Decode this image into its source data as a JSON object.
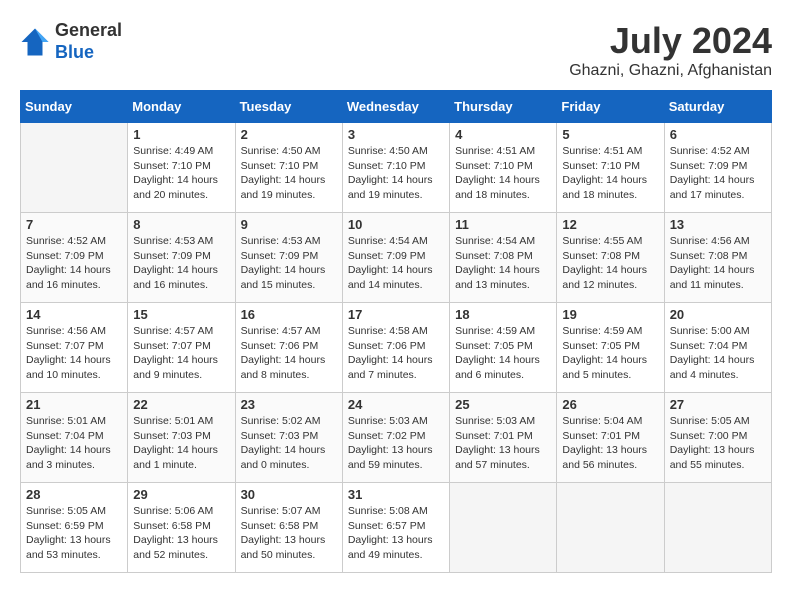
{
  "header": {
    "logo_line1": "General",
    "logo_line2": "Blue",
    "month_year": "July 2024",
    "location": "Ghazni, Ghazni, Afghanistan"
  },
  "weekdays": [
    "Sunday",
    "Monday",
    "Tuesday",
    "Wednesday",
    "Thursday",
    "Friday",
    "Saturday"
  ],
  "weeks": [
    [
      {
        "day": "",
        "info": ""
      },
      {
        "day": "1",
        "info": "Sunrise: 4:49 AM\nSunset: 7:10 PM\nDaylight: 14 hours\nand 20 minutes."
      },
      {
        "day": "2",
        "info": "Sunrise: 4:50 AM\nSunset: 7:10 PM\nDaylight: 14 hours\nand 19 minutes."
      },
      {
        "day": "3",
        "info": "Sunrise: 4:50 AM\nSunset: 7:10 PM\nDaylight: 14 hours\nand 19 minutes."
      },
      {
        "day": "4",
        "info": "Sunrise: 4:51 AM\nSunset: 7:10 PM\nDaylight: 14 hours\nand 18 minutes."
      },
      {
        "day": "5",
        "info": "Sunrise: 4:51 AM\nSunset: 7:10 PM\nDaylight: 14 hours\nand 18 minutes."
      },
      {
        "day": "6",
        "info": "Sunrise: 4:52 AM\nSunset: 7:09 PM\nDaylight: 14 hours\nand 17 minutes."
      }
    ],
    [
      {
        "day": "7",
        "info": "Sunrise: 4:52 AM\nSunset: 7:09 PM\nDaylight: 14 hours\nand 16 minutes."
      },
      {
        "day": "8",
        "info": "Sunrise: 4:53 AM\nSunset: 7:09 PM\nDaylight: 14 hours\nand 16 minutes."
      },
      {
        "day": "9",
        "info": "Sunrise: 4:53 AM\nSunset: 7:09 PM\nDaylight: 14 hours\nand 15 minutes."
      },
      {
        "day": "10",
        "info": "Sunrise: 4:54 AM\nSunset: 7:09 PM\nDaylight: 14 hours\nand 14 minutes."
      },
      {
        "day": "11",
        "info": "Sunrise: 4:54 AM\nSunset: 7:08 PM\nDaylight: 14 hours\nand 13 minutes."
      },
      {
        "day": "12",
        "info": "Sunrise: 4:55 AM\nSunset: 7:08 PM\nDaylight: 14 hours\nand 12 minutes."
      },
      {
        "day": "13",
        "info": "Sunrise: 4:56 AM\nSunset: 7:08 PM\nDaylight: 14 hours\nand 11 minutes."
      }
    ],
    [
      {
        "day": "14",
        "info": "Sunrise: 4:56 AM\nSunset: 7:07 PM\nDaylight: 14 hours\nand 10 minutes."
      },
      {
        "day": "15",
        "info": "Sunrise: 4:57 AM\nSunset: 7:07 PM\nDaylight: 14 hours\nand 9 minutes."
      },
      {
        "day": "16",
        "info": "Sunrise: 4:57 AM\nSunset: 7:06 PM\nDaylight: 14 hours\nand 8 minutes."
      },
      {
        "day": "17",
        "info": "Sunrise: 4:58 AM\nSunset: 7:06 PM\nDaylight: 14 hours\nand 7 minutes."
      },
      {
        "day": "18",
        "info": "Sunrise: 4:59 AM\nSunset: 7:05 PM\nDaylight: 14 hours\nand 6 minutes."
      },
      {
        "day": "19",
        "info": "Sunrise: 4:59 AM\nSunset: 7:05 PM\nDaylight: 14 hours\nand 5 minutes."
      },
      {
        "day": "20",
        "info": "Sunrise: 5:00 AM\nSunset: 7:04 PM\nDaylight: 14 hours\nand 4 minutes."
      }
    ],
    [
      {
        "day": "21",
        "info": "Sunrise: 5:01 AM\nSunset: 7:04 PM\nDaylight: 14 hours\nand 3 minutes."
      },
      {
        "day": "22",
        "info": "Sunrise: 5:01 AM\nSunset: 7:03 PM\nDaylight: 14 hours\nand 1 minute."
      },
      {
        "day": "23",
        "info": "Sunrise: 5:02 AM\nSunset: 7:03 PM\nDaylight: 14 hours\nand 0 minutes."
      },
      {
        "day": "24",
        "info": "Sunrise: 5:03 AM\nSunset: 7:02 PM\nDaylight: 13 hours\nand 59 minutes."
      },
      {
        "day": "25",
        "info": "Sunrise: 5:03 AM\nSunset: 7:01 PM\nDaylight: 13 hours\nand 57 minutes."
      },
      {
        "day": "26",
        "info": "Sunrise: 5:04 AM\nSunset: 7:01 PM\nDaylight: 13 hours\nand 56 minutes."
      },
      {
        "day": "27",
        "info": "Sunrise: 5:05 AM\nSunset: 7:00 PM\nDaylight: 13 hours\nand 55 minutes."
      }
    ],
    [
      {
        "day": "28",
        "info": "Sunrise: 5:05 AM\nSunset: 6:59 PM\nDaylight: 13 hours\nand 53 minutes."
      },
      {
        "day": "29",
        "info": "Sunrise: 5:06 AM\nSunset: 6:58 PM\nDaylight: 13 hours\nand 52 minutes."
      },
      {
        "day": "30",
        "info": "Sunrise: 5:07 AM\nSunset: 6:58 PM\nDaylight: 13 hours\nand 50 minutes."
      },
      {
        "day": "31",
        "info": "Sunrise: 5:08 AM\nSunset: 6:57 PM\nDaylight: 13 hours\nand 49 minutes."
      },
      {
        "day": "",
        "info": ""
      },
      {
        "day": "",
        "info": ""
      },
      {
        "day": "",
        "info": ""
      }
    ]
  ]
}
